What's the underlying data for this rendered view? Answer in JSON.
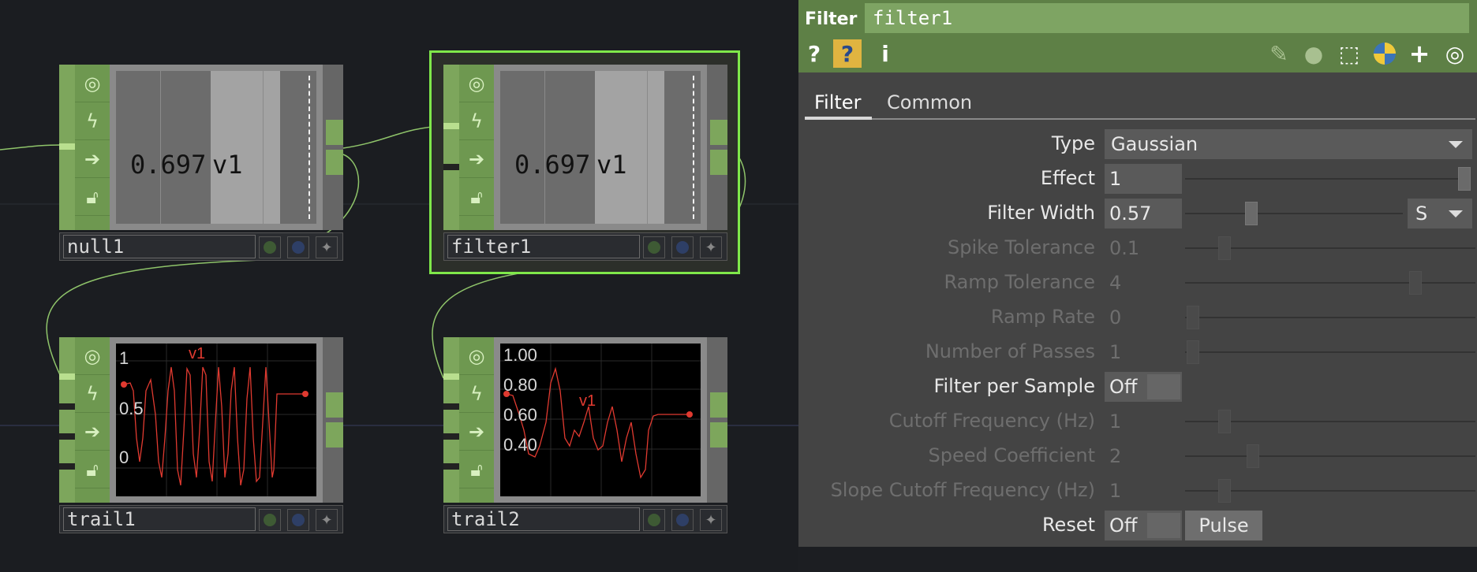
{
  "network": {
    "nodes": [
      {
        "id": "null1",
        "name": "null1",
        "value": "0.697",
        "channel": "v1"
      },
      {
        "id": "filter1",
        "name": "filter1",
        "value": "0.697",
        "channel": "v1",
        "selected": true
      },
      {
        "id": "trail1",
        "name": "trail1",
        "channel": "v1",
        "ticks": [
          "1",
          "0.5",
          "0"
        ]
      },
      {
        "id": "trail2",
        "name": "trail2",
        "channel": "v1",
        "ticks": [
          "1.00",
          "0.80",
          "0.60",
          "0.40"
        ]
      }
    ],
    "colors": {
      "op_green": "#7da65c",
      "selected_outline": "#7fe84a",
      "trace": "#e03a30",
      "wire": "#8fc46a"
    },
    "icons": [
      "viewer-icon",
      "cook-icon",
      "export-icon",
      "lock-icon",
      "bypass-flag-icon",
      "display-flag-icon",
      "pin-icon"
    ]
  },
  "panel": {
    "op_type": "Filter",
    "op_name": "filter1",
    "toolbar_icons": [
      "help-icon",
      "python-help-icon",
      "info-icon",
      "edit-icon",
      "comment-icon",
      "clone-icon",
      "python-icon",
      "add-icon",
      "target-icon"
    ],
    "tabs": [
      "Filter",
      "Common"
    ],
    "active_tab": "Filter",
    "params": {
      "type": {
        "label": "Type",
        "value": "Gaussian"
      },
      "effect": {
        "label": "Effect",
        "value": "1"
      },
      "filter_width": {
        "label": "Filter Width",
        "value": "0.57",
        "unit": "S"
      },
      "spike_tolerance": {
        "label": "Spike Tolerance",
        "value": "0.1"
      },
      "ramp_tolerance": {
        "label": "Ramp Tolerance",
        "value": "4"
      },
      "ramp_rate": {
        "label": "Ramp Rate",
        "value": "0"
      },
      "number_of_passes": {
        "label": "Number of Passes",
        "value": "1"
      },
      "filter_per_sample": {
        "label": "Filter per Sample",
        "value": "Off"
      },
      "cutoff_frequency": {
        "label": "Cutoff Frequency (Hz)",
        "value": "1"
      },
      "speed_coefficient": {
        "label": "Speed Coefficient",
        "value": "2"
      },
      "slope_cutoff": {
        "label": "Slope Cutoff Frequency (Hz)",
        "value": "1"
      },
      "reset": {
        "label": "Reset",
        "value": "Off",
        "pulse": "Pulse"
      }
    }
  }
}
